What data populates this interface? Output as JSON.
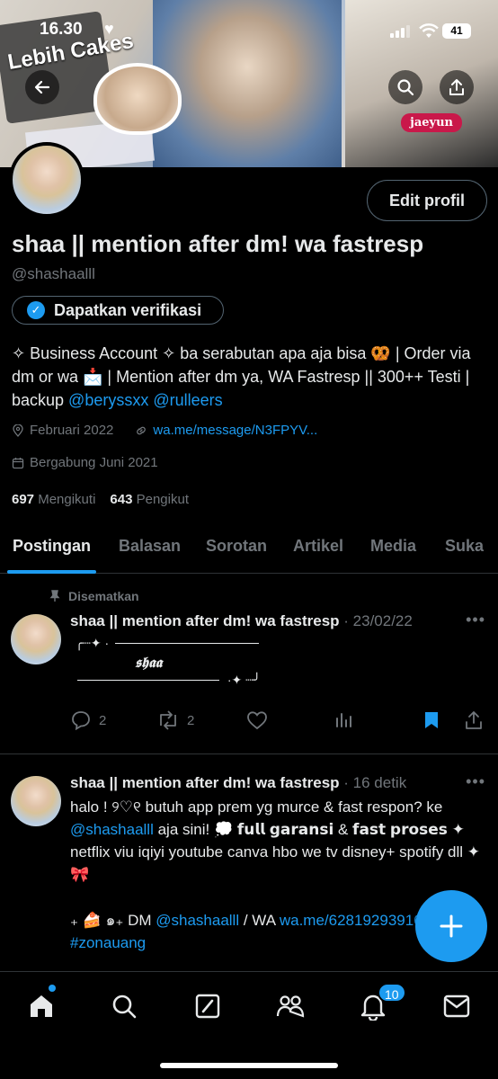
{
  "status_bar": {
    "time": "16.30",
    "battery": "41"
  },
  "banner": {
    "tag": "jaeyun",
    "sign": "Lebih Cakes"
  },
  "profile": {
    "edit_label": "Edit profil",
    "name": "shaa || mention after dm! wa fastresp",
    "handle": "@shashaalll",
    "verify_label": "Dapatkan verifikasi",
    "bio_text": "✧ Business Account ✧ ba serabutan apa aja bisa 🥨 | Order via dm or wa 📩 | Mention after dm ya, WA Fastresp || 300++ Testi | backup ",
    "bio_mention_1": "@beryssxx",
    "bio_mention_2": "@rulleers",
    "location": "Februari 2022",
    "link": "wa.me/message/N3FPYV...",
    "joined": "Bergabung Juni 2021",
    "following_count": "697",
    "following_label": "Mengikuti",
    "followers_count": "643",
    "followers_label": "Pengikut"
  },
  "tabs": [
    {
      "label": "Postingan"
    },
    {
      "label": "Balasan"
    },
    {
      "label": "Sorotan"
    },
    {
      "label": "Artikel"
    },
    {
      "label": "Media"
    },
    {
      "label": "Suka"
    }
  ],
  "posts": [
    {
      "pinned_label": "Disematkan",
      "author": "shaa || mention after dm! wa fastresp",
      "meta": "· 23/02/22",
      "art_top": "╭┈✦ ·",
      "art_mid": "𝖘𝖍𝖆𝖆",
      "art_bottom": "·✦ ┈╯",
      "replies": "2",
      "reposts": "2"
    },
    {
      "author": "shaa || mention after dm! wa fastresp",
      "meta": "· 16 detik",
      "line1": "halo ! ୨♡୧ butuh app prem yg murce & fast respon? ke ",
      "mention1": "@shashaalll",
      "line1b": " aja sini! 💭 𝗳𝘂𝗹𝗹 𝗴𝗮𝗿𝗮𝗻𝘀𝗶 & 𝗳𝗮𝘀𝘁 𝗽𝗿𝗼𝘀𝗲𝘀 ✦ netflix viu iqiyi youtube canva hbo we tv disney+ spotify dll ✦ 🎀",
      "line2": "₊ 🍰 ๑₊ DM ",
      "mention2": "@shashaalll",
      "line2b": " / WA ",
      "link": "wa.me/6281929391605",
      "hashtag": "#zonauang"
    }
  ],
  "bottom_nav": {
    "notif_badge": "10"
  },
  "colors": {
    "accent": "#1d9bf0",
    "background": "#000000",
    "muted": "#71767b",
    "text": "#e7e9ea"
  }
}
